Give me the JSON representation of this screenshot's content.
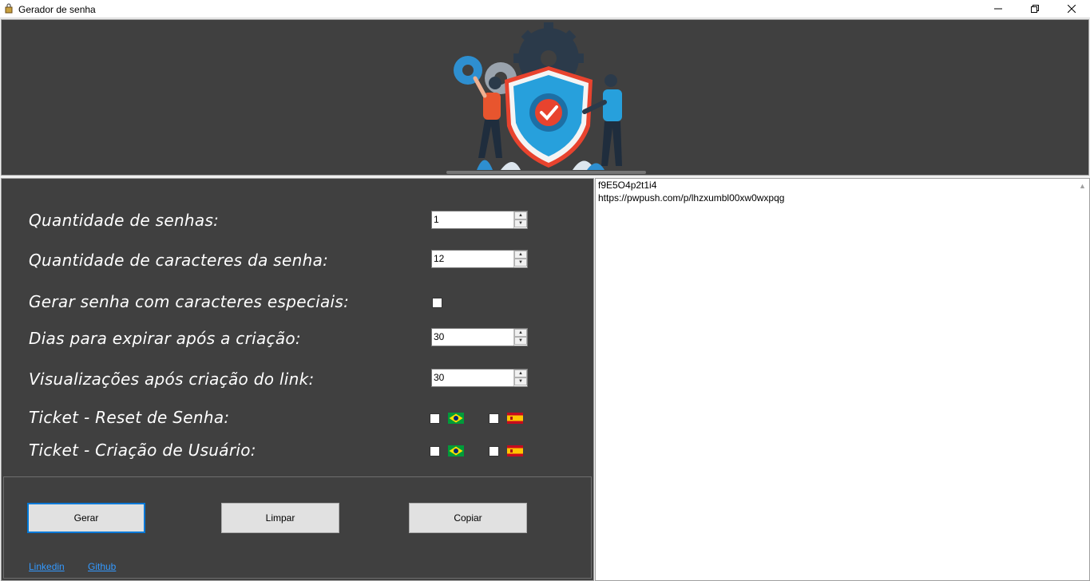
{
  "window": {
    "title": "Gerador de senha",
    "minimize_glyph": "—",
    "maximize_glyph": "❐",
    "close_glyph": "✕"
  },
  "banner": {
    "illustration": "security-shield-illustration"
  },
  "form": {
    "quantidade_senhas": {
      "label": "Quantidade de senhas:",
      "value": "1"
    },
    "quantidade_caracteres": {
      "label": "Quantidade de caracteres da senha:",
      "value": "12"
    },
    "caracteres_especiais": {
      "label": "Gerar senha com caracteres especiais:",
      "checked": false
    },
    "dias_expirar": {
      "label": "Dias para expirar após a criação:",
      "value": "30"
    },
    "visualizacoes": {
      "label": "Visualizações após criação do link:",
      "value": "30"
    },
    "ticket_reset": {
      "label": "Ticket - Reset de Senha:",
      "br_checked": false,
      "es_checked": false
    },
    "ticket_criacao": {
      "label": "Ticket - Criação de Usuário:",
      "br_checked": false,
      "es_checked": false
    }
  },
  "buttons": {
    "gerar": "Gerar",
    "limpar": "Limpar",
    "copiar": "Copiar"
  },
  "links": {
    "linkedin": "Linkedin",
    "github": "Github"
  },
  "output": {
    "lines": [
      "f9E5O4p2t1i4",
      "https://pwpush.com/p/lhzxumbl00xw0wxpqg"
    ]
  },
  "colors": {
    "panel_bg": "#404040",
    "accent": "#0078d7",
    "link": "#3399ff"
  }
}
